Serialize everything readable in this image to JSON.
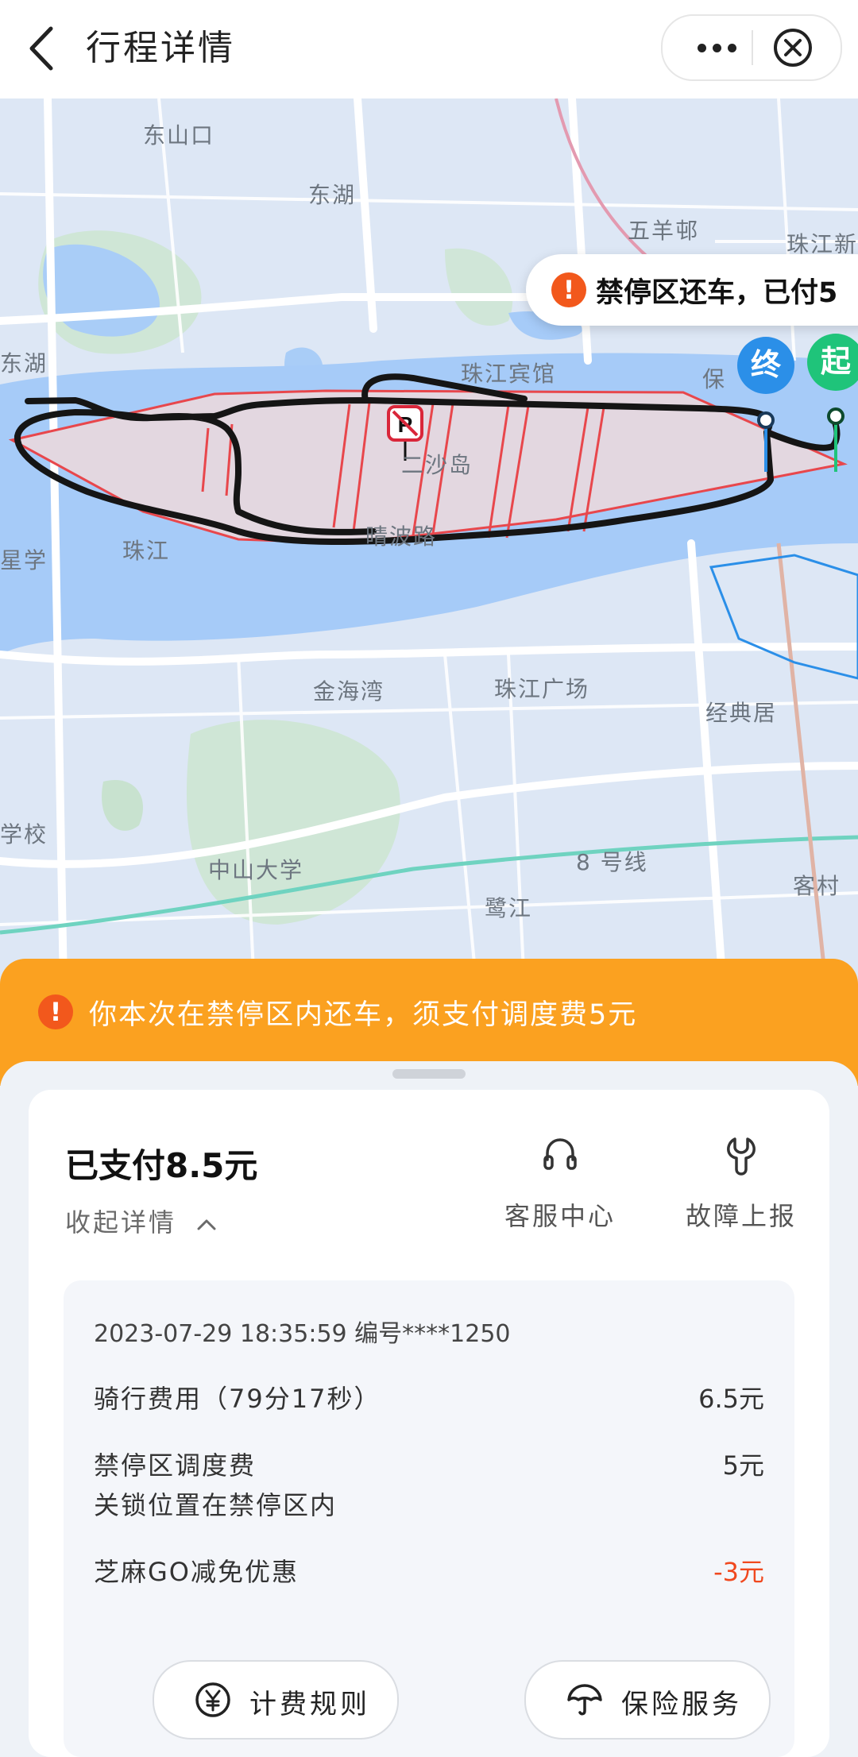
{
  "header": {
    "title": "行程详情"
  },
  "map": {
    "labels": [
      "东山口",
      "东湖",
      "五羊邨",
      "珠江新",
      "珠江宾馆",
      "东湖",
      "保",
      "珠江",
      "二沙岛",
      "晴波路",
      "星学",
      "金海湾",
      "珠江广场",
      "经典居",
      "学校",
      "中山大学",
      "8 号线",
      "鹭江",
      "客村"
    ],
    "callout": "禁停区还车，已付5",
    "pin_end": "终",
    "pin_start": "起"
  },
  "banner": {
    "message": "你本次在禁停区内还车，须支付调度费5元"
  },
  "summary": {
    "paid": "已支付8.5元",
    "collapse_label": "收起详情",
    "customer_service": "客服中心",
    "fault_report": "故障上报"
  },
  "details": {
    "meta": "2023-07-29 18:35:59 编号****1250",
    "rows": [
      {
        "label": "骑行费用（79分17秒）",
        "value": "6.5元"
      },
      {
        "label": "禁停区调度费",
        "value": "5元"
      },
      {
        "label": "关锁位置在禁停区内"
      },
      {
        "label": "芝麻GO减免优惠",
        "value": "-3元"
      }
    ]
  },
  "buttons": {
    "fee_rules": "计费规则",
    "insurance": "保险服务"
  },
  "colors": {
    "orange": "#fba120",
    "alert": "#f2581c",
    "discount": "#f0481e",
    "start": "#1fc47a",
    "end": "#2b8fe8"
  }
}
